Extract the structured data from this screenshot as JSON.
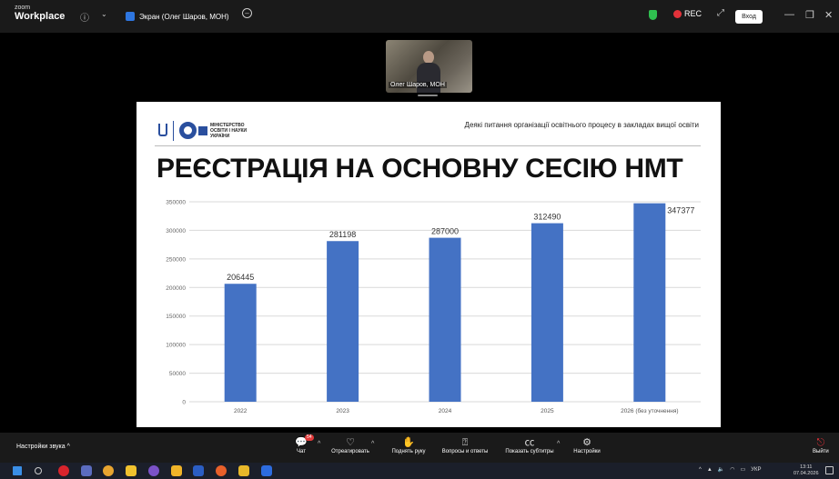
{
  "app": {
    "logo_line1": "zoom",
    "logo_line2": "Workplace",
    "share_tab": "Экран (Олег Шаров, МОН)",
    "rec_label": "REC",
    "login_button": "Вход"
  },
  "video_tile": {
    "participant_name": "Олег Шаров, МОН"
  },
  "slide": {
    "ministry_lines": [
      "МІНІСТЕРСТВО",
      "ОСВІТИ І НАУКИ",
      "УКРАЇНИ"
    ],
    "subject": "Деякі питання організації освітнього процесу в закладах вищої освіти",
    "title": "РЕЄСТРАЦІЯ НА ОСНОВНУ СЕСІЮ НМТ"
  },
  "chart_data": {
    "type": "bar",
    "title": "",
    "xlabel": "",
    "ylabel": "",
    "categories": [
      "2022",
      "2023",
      "2024",
      "2025",
      "2026 (без уточнення)"
    ],
    "values": [
      206445,
      281198,
      287000,
      312490,
      347377
    ],
    "value_labels": [
      "206445",
      "281198",
      "287000",
      "312490",
      "347377"
    ],
    "ylim": [
      0,
      350000
    ],
    "yticks": [
      0,
      50000,
      100000,
      150000,
      200000,
      250000,
      300000,
      350000
    ],
    "ytick_labels": [
      "0",
      "50000",
      "100000",
      "150000",
      "200000",
      "250000",
      "300000",
      "350000"
    ],
    "grid": true,
    "legend": "none",
    "bar_color": "#4472c4"
  },
  "toolbar": {
    "audio_settings": "Настройки звука",
    "chat_badge": "54",
    "items": [
      "Чат",
      "Отреагировать",
      "Поднять руку",
      "Вопросы и ответы",
      "Показать субтитры",
      "Настройки"
    ],
    "exit": "Выйти"
  },
  "taskbar": {
    "language": "УКР",
    "time": "13:11",
    "date": "07.04.2026"
  },
  "colors": {
    "accent_blue": "#2a4f9e",
    "rec_red": "#e2323a",
    "shield_green": "#2fbf4f"
  }
}
